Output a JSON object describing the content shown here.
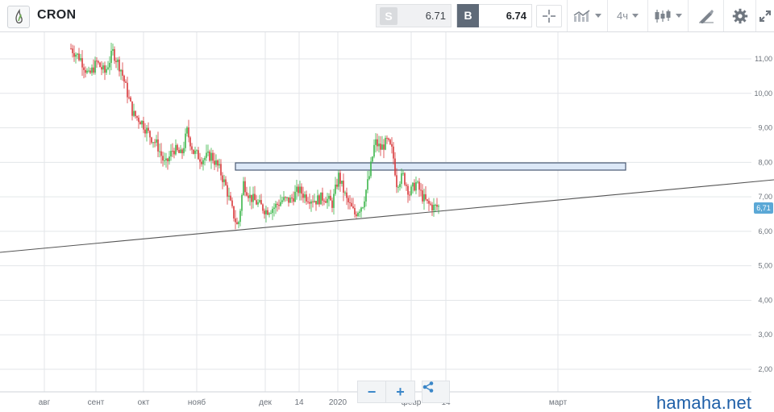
{
  "header": {
    "ticker": "CRON",
    "logo_icon": "leaf-drop-logo-icon",
    "sell": {
      "tag": "S",
      "price": "6.71"
    },
    "buy": {
      "tag": "B",
      "price": "6.74"
    },
    "tools": {
      "crosshair_icon": "crosshair-icon",
      "indicators_icon": "indicators-icon",
      "timeframe": "4ч",
      "chart_type_icon": "candlestick-icon",
      "drawing_icon": "drawing-tools-icon",
      "settings_icon": "gear-icon",
      "fullscreen_icon": "expand-icon"
    }
  },
  "chart": {
    "y_ticks": [
      "11,00",
      "10,00",
      "9,00",
      "8,00",
      "7,00",
      "6,00",
      "5,00",
      "4,00",
      "3,00",
      "2,00"
    ],
    "x_ticks": [
      "авг",
      "сент",
      "окт",
      "нояб",
      "дек",
      "14",
      "2020",
      "февр",
      "14",
      "март"
    ],
    "last_price": "6,71",
    "colors": {
      "up": "#3bb54a",
      "down": "#d8383a",
      "grid": "#e3e6e9",
      "trendline": "#555555",
      "zone_fill": "#dce8f7",
      "zone_stroke": "#4a5a73",
      "price_tag": "#5ba8d6"
    }
  },
  "zoom": {
    "minus": "−",
    "plus": "+",
    "share_icon": "share-icon"
  },
  "watermark": "hamaha.net"
}
